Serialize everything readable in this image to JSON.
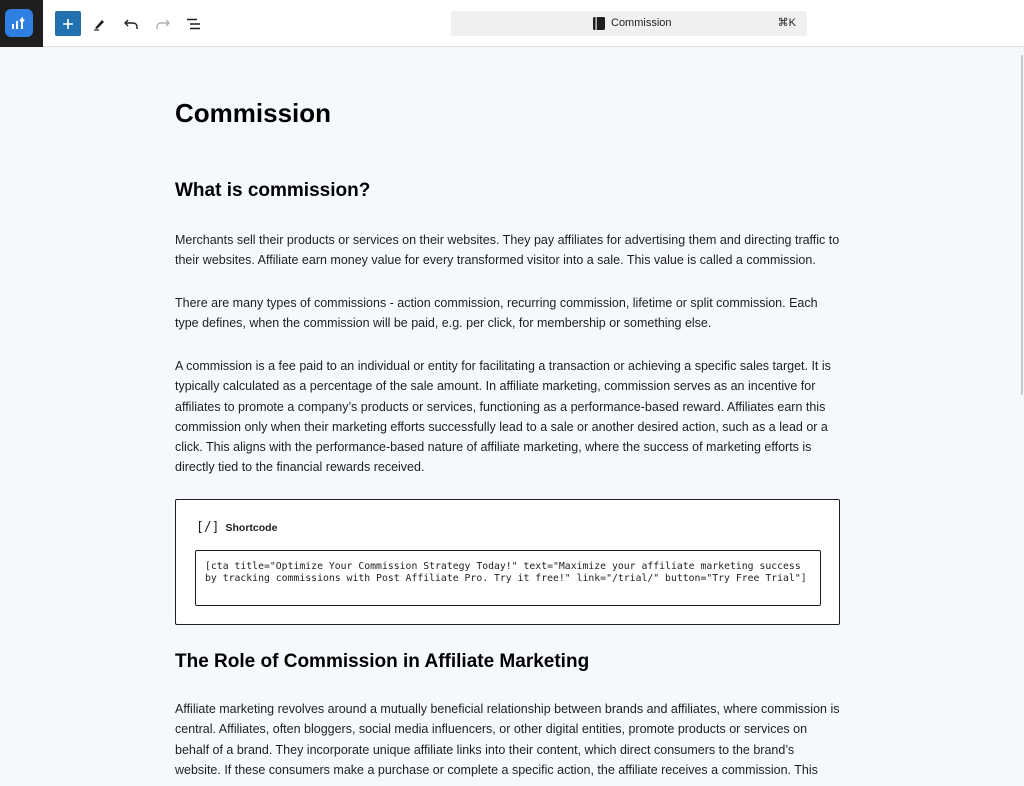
{
  "toolbar": {
    "add_icon": "plus-icon",
    "tools_icon": "pen-icon",
    "undo_icon": "undo-icon",
    "redo_icon": "redo-icon",
    "outline_icon": "list-view-icon"
  },
  "command_bar": {
    "title": "Commission",
    "shortcut": "⌘K",
    "icon": "page-icon"
  },
  "document": {
    "title": "Commission",
    "h2_1": "What is commission?",
    "p1": "Merchants sell their products or services on their websites. They pay affiliates for advertising them and directing traffic to their websites. Affiliate earn money value for every transformed visitor into a sale. This value is called a commission.",
    "p2": "There are many types of commissions - action commission, recurring commission, lifetime or split commission. Each type defines, when the commission will be paid, e.g. per click, for membership or something else.",
    "p3": "A commission is a fee paid to an individual or entity for facilitating a transaction or achieving a specific sales target. It is typically calculated as a percentage of the sale amount. In affiliate marketing, commission serves as an incentive for affiliates to promote a company’s products or services, functioning as a performance-based reward. Affiliates earn this commission only when their marketing efforts successfully lead to a sale or another desired action, such as a lead or a click. This aligns with the performance-based nature of affiliate marketing, where the success of marketing efforts is directly tied to the financial rewards received.",
    "shortcode": {
      "icon_text": "[/]",
      "label": "Shortcode",
      "value": "[cta title=\"Optimize Your Commission Strategy Today!\" text=\"Maximize your affiliate marketing success by tracking commissions with Post Affiliate Pro. Try it free!\" link=\"/trial/\" button=\"Try Free Trial\"]"
    },
    "h2_2": "The Role of Commission in Affiliate Marketing",
    "p4": "Affiliate marketing revolves around a mutually beneficial relationship between brands and affiliates, where commission is central. Affiliates, often bloggers, social media influencers, or other digital entities, promote products or services on behalf of a brand. They incorporate unique affiliate links into their content, which direct consumers to the brand’s website. If these consumers make a purchase or complete a specific action, the affiliate receives a commission. This"
  }
}
